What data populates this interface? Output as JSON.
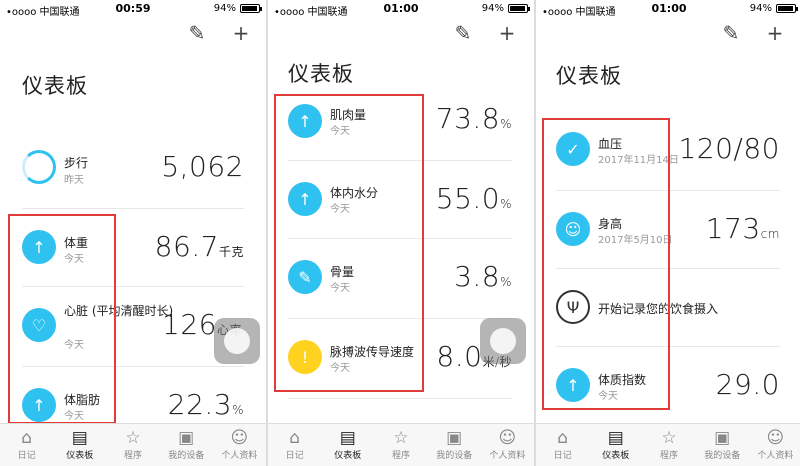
{
  "status": {
    "carrier": "•oooo 中国联通",
    "battery": "94%",
    "battery_level": 0.94,
    "times": [
      "00:59",
      "01:00",
      "01:00"
    ]
  },
  "title": "仪表板",
  "tabs": [
    "日记",
    "仪表板",
    "程序",
    "我的设备",
    "个人资料"
  ],
  "screen1": {
    "rows": [
      {
        "label": "步行",
        "sub": "昨天",
        "value": "5,062",
        "unit": ""
      },
      {
        "label": "体重",
        "sub": "今天",
        "value": "86.7",
        "unit": "千克"
      },
      {
        "label": "心脏 (平均清醒时长)",
        "sub": "今天",
        "value": "126",
        "unit": "心率"
      },
      {
        "label": "体脂肪",
        "sub": "今天",
        "value": "22.3",
        "unit": "%"
      }
    ]
  },
  "screen2": {
    "rows": [
      {
        "label": "肌肉量",
        "sub": "今天",
        "value": "73.8",
        "unit": "%"
      },
      {
        "label": "体内水分",
        "sub": "今天",
        "value": "55.0",
        "unit": "%"
      },
      {
        "label": "骨量",
        "sub": "今天",
        "value": "3.8",
        "unit": "%"
      },
      {
        "label": "脉搏波传导速度",
        "sub": "今天",
        "value": "8.0",
        "unit": "米/秒"
      }
    ]
  },
  "screen3": {
    "rows": [
      {
        "label": "血压",
        "sub": "2017年11月14日",
        "value": "120/80",
        "unit": ""
      },
      {
        "label": "身高",
        "sub": "2017年5月10日",
        "value": "173",
        "unit": "cm"
      },
      {
        "label": "开始记录您的饮食摄入",
        "sub": "",
        "value": "",
        "unit": ""
      },
      {
        "label": "体质指数",
        "sub": "今天",
        "value": "29.0",
        "unit": ""
      }
    ]
  }
}
